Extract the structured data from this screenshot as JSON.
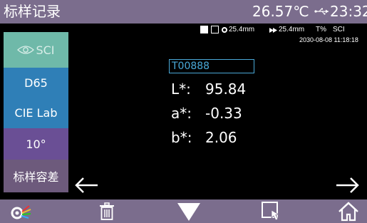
{
  "header": {
    "title": "标样记录",
    "temperature": "26.57℃",
    "usb_icon": "usb-icon",
    "time": "23:32"
  },
  "info": {
    "aperture_1": "25.4mm",
    "aperture_2": "25.4mm",
    "mode": "T%",
    "specular": "SCI",
    "datetime": "2030-08-08 11:18:18"
  },
  "sidebar": {
    "items": [
      {
        "label": "SCI",
        "icon": "eye-icon"
      },
      {
        "label": "D65"
      },
      {
        "label": "CIE Lab"
      },
      {
        "label": "10°"
      },
      {
        "label": "标样容差"
      }
    ]
  },
  "sample": {
    "id": "T00888",
    "values": [
      {
        "label": "L*:",
        "value": "95.84"
      },
      {
        "label": "a*:",
        "value": "-0.33"
      },
      {
        "label": "b*:",
        "value": "2.06"
      }
    ]
  },
  "toolbar": {
    "icons": [
      "color-measure-icon",
      "trash-icon",
      "down-triangle-icon",
      "pointer-select-icon",
      "home-icon"
    ]
  },
  "colors": {
    "title_bar": "#7b6d8d",
    "sci_button": "#6fb9a9",
    "illuminant_button": "#2f7fb7",
    "observer_button": "#6a4f95",
    "tolerance_button": "#6d5a7c",
    "sample_id_border": "#4aa9d8"
  }
}
